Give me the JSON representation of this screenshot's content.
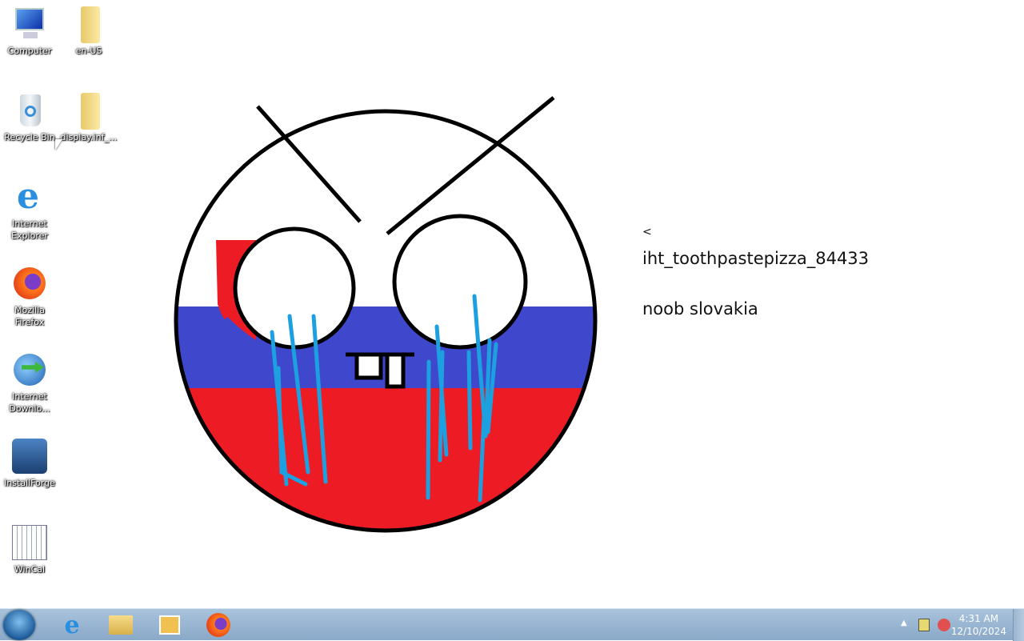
{
  "desktop": {
    "icons": [
      {
        "label": "Computer",
        "icon": "computer-icon"
      },
      {
        "label": "en-US",
        "icon": "folder-icon"
      },
      {
        "label": "Recycle Bin",
        "icon": "recycle-bin-icon"
      },
      {
        "label": "display.inf_...",
        "icon": "folder-icon"
      },
      {
        "label": "Internet Explorer",
        "icon": "internet-explorer-icon"
      },
      {
        "label": "Mozilla Firefox",
        "icon": "firefox-icon"
      },
      {
        "label": "Internet Downlo...",
        "icon": "internet-download-manager-icon"
      },
      {
        "label": "InstallForge",
        "icon": "installforge-icon"
      },
      {
        "label": "WinCal",
        "icon": "calendar-icon"
      }
    ]
  },
  "wallpaper": {
    "line1": "<",
    "line2": "iht_toothpastepizza_84433",
    "line3": "noob slovakia",
    "colors": {
      "white": "#ffffff",
      "blue": "#3f48cc",
      "red": "#ed1c24",
      "tears": "#1ca0e0",
      "outline": "#000000"
    }
  },
  "taskbar": {
    "pinned": [
      "internet-explorer-icon",
      "file-explorer-icon",
      "media-player-icon",
      "firefox-icon"
    ],
    "time": "4:31 AM",
    "date": "12/10/2024"
  }
}
